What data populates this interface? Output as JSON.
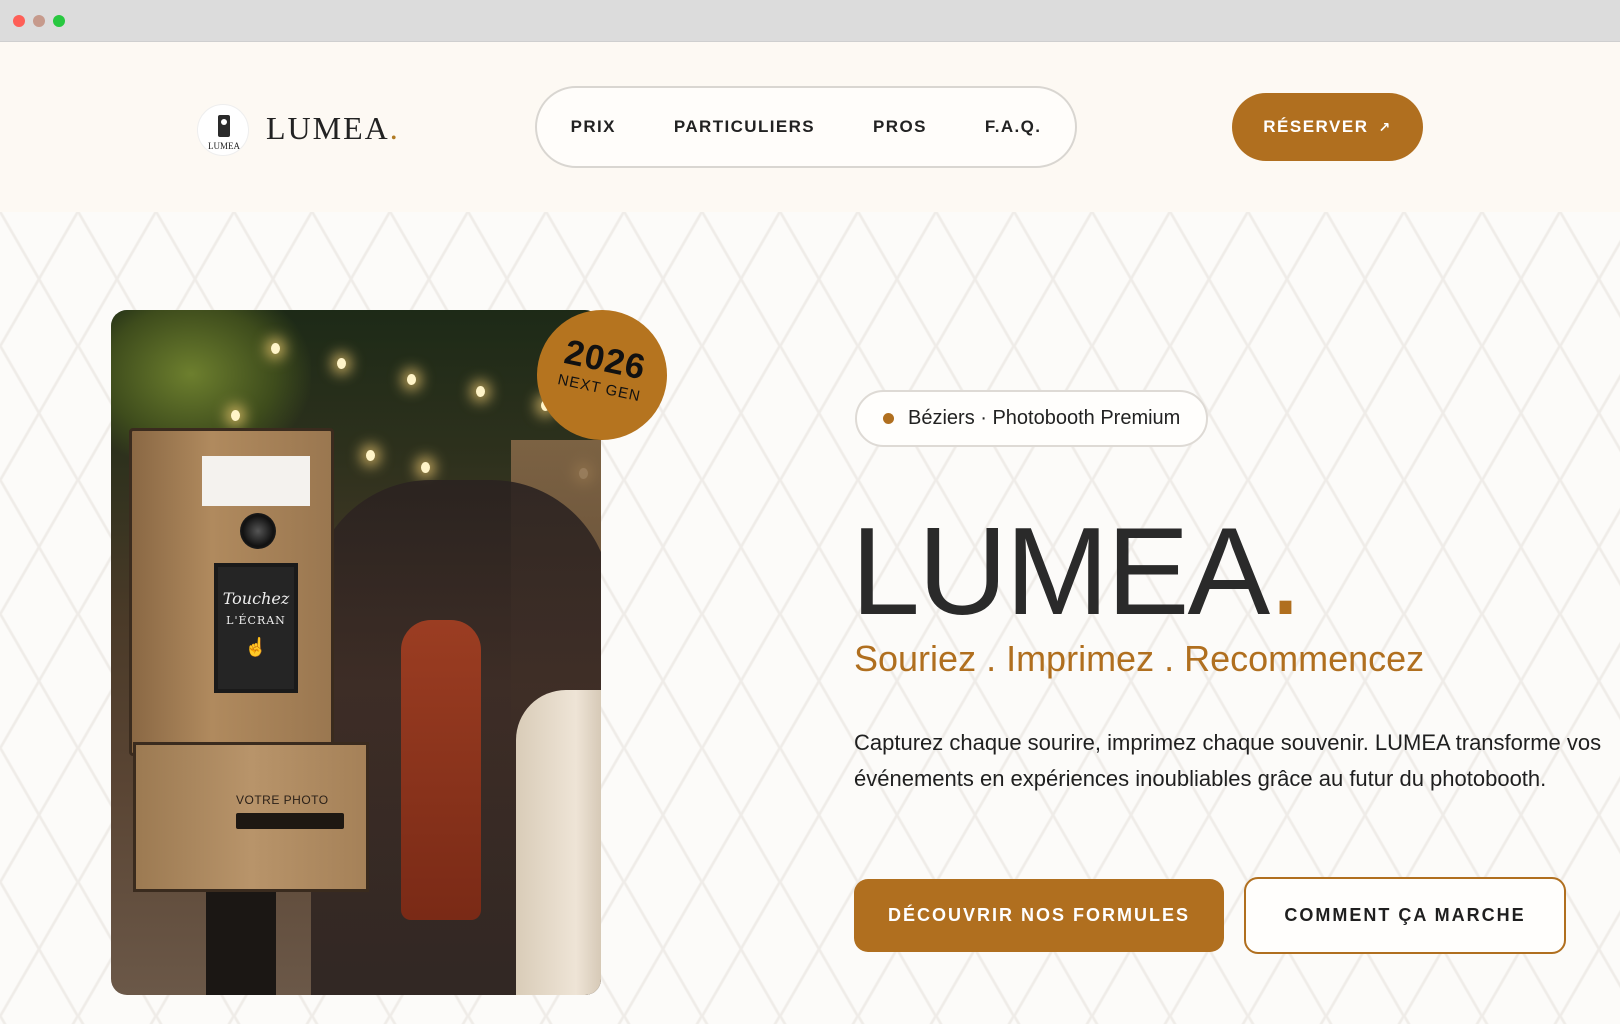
{
  "colors": {
    "accent": "#b06f1f",
    "text": "#222222",
    "header_bg": "#fdf9f3"
  },
  "header": {
    "logo_small_text": "LUMEA",
    "brand_name": "LUMEA",
    "brand_dot": ".",
    "nav": [
      {
        "label": "PRIX"
      },
      {
        "label": "PARTICULIERS"
      },
      {
        "label": "PROS"
      },
      {
        "label": "F.A.Q."
      }
    ],
    "cta_label": "RÉSERVER",
    "cta_icon": "arrow-up-right-icon"
  },
  "hero": {
    "badge": {
      "year": "2026",
      "subtitle": "NEXT GEN"
    },
    "image": {
      "screen_line1": "Touchez",
      "screen_line2": "L'ÉCRAN",
      "booth_label": "VOTRE PHOTO"
    },
    "location_pill": "Béziers · Photobooth Premium",
    "title": "LUMEA",
    "title_dot": ".",
    "tagline": "Souriez . Imprimez . Recommencez",
    "description": "Capturez chaque sourire, imprimez chaque souvenir. LUMEA transforme vos événements en expériences inoubliables grâce au futur du photobooth.",
    "primary_button": "DÉCOUVRIR NOS FORMULES",
    "secondary_button": "COMMENT ÇA MARCHE"
  }
}
